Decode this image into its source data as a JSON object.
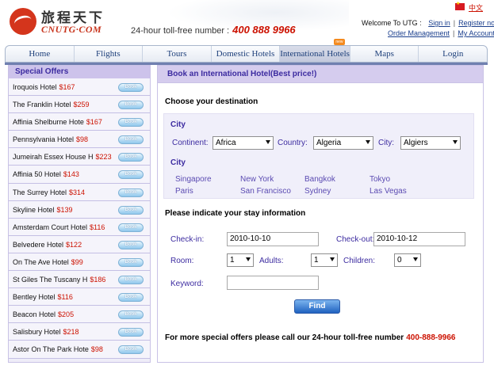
{
  "header": {
    "logo_cn": "旅程天下",
    "logo_en": "CNUTG·COM",
    "tollfree_label": "24-hour toll-free number :",
    "tollfree_number": "400 888 9966",
    "lang_link": "中文",
    "welcome": "Welcome To UTG :",
    "sign_in": "Sign in",
    "register": "Register now",
    "order_mgmt": "Order Management",
    "my_account": "My Account",
    "separator": "|"
  },
  "nav": {
    "items": [
      {
        "label": "Home"
      },
      {
        "label": "Flights"
      },
      {
        "label": "Tours"
      },
      {
        "label": "Domestic Hotels"
      },
      {
        "label": "International Hotels"
      },
      {
        "label": "Maps"
      },
      {
        "label": "Login"
      }
    ],
    "active_index": 4,
    "badge": "new"
  },
  "sidebar": {
    "title": "Special Offers",
    "book_label": "Book",
    "offers": [
      {
        "name": "Iroquois Hotel",
        "price": "$167"
      },
      {
        "name": "The Franklin Hotel",
        "price": "$259"
      },
      {
        "name": "Affinia Shelburne Hote",
        "price": "$167"
      },
      {
        "name": "Pennsylvania Hotel",
        "price": "$98"
      },
      {
        "name": "Jumeirah Essex House H",
        "price": "$223"
      },
      {
        "name": "Affinia 50 Hotel",
        "price": "$143"
      },
      {
        "name": "The Surrey Hotel",
        "price": "$314"
      },
      {
        "name": "Skyline Hotel",
        "price": "$139"
      },
      {
        "name": "Amsterdam Court Hotel",
        "price": "$116"
      },
      {
        "name": "Belvedere Hotel",
        "price": "$122"
      },
      {
        "name": "On The Ave Hotel",
        "price": "$99"
      },
      {
        "name": "St Giles The Tuscany H",
        "price": "$186"
      },
      {
        "name": "Bentley Hotel",
        "price": "$116"
      },
      {
        "name": "Beacon Hotel",
        "price": "$205"
      },
      {
        "name": "Salisbury Hotel",
        "price": "$218"
      },
      {
        "name": "Astor On The Park Hote",
        "price": "$98"
      }
    ]
  },
  "main": {
    "title": "Book an International Hotel(Best price!)",
    "choose_destination": "Choose your destination",
    "city_label": "City",
    "continent_label": "Continent:",
    "continent_value": "Africa",
    "country_label": "Country:",
    "country_value": "Algeria",
    "city_field_label": "City:",
    "city_value": "Algiers",
    "popular_label": "City",
    "popular_cities": [
      "Singapore",
      "New York",
      "Bangkok",
      "Tokyo",
      "Paris",
      "San Francisco",
      "Sydney",
      "Las Vegas"
    ],
    "stay_info": "Please indicate your stay information",
    "checkin_label": "Check-in:",
    "checkin_value": "2010-10-10",
    "checkout_label": "Check-out:",
    "checkout_value": "2010-10-12",
    "room_label": "Room:",
    "room_value": "1",
    "adults_label": "Adults:",
    "adults_value": "1",
    "children_label": "Children:",
    "children_value": "0",
    "keyword_label": "Keyword:",
    "keyword_value": "",
    "find_label": "Find",
    "bottom_note": "For more special offers please call our 24-hour toll-free number",
    "bottom_phone": "400-888-9966"
  }
}
